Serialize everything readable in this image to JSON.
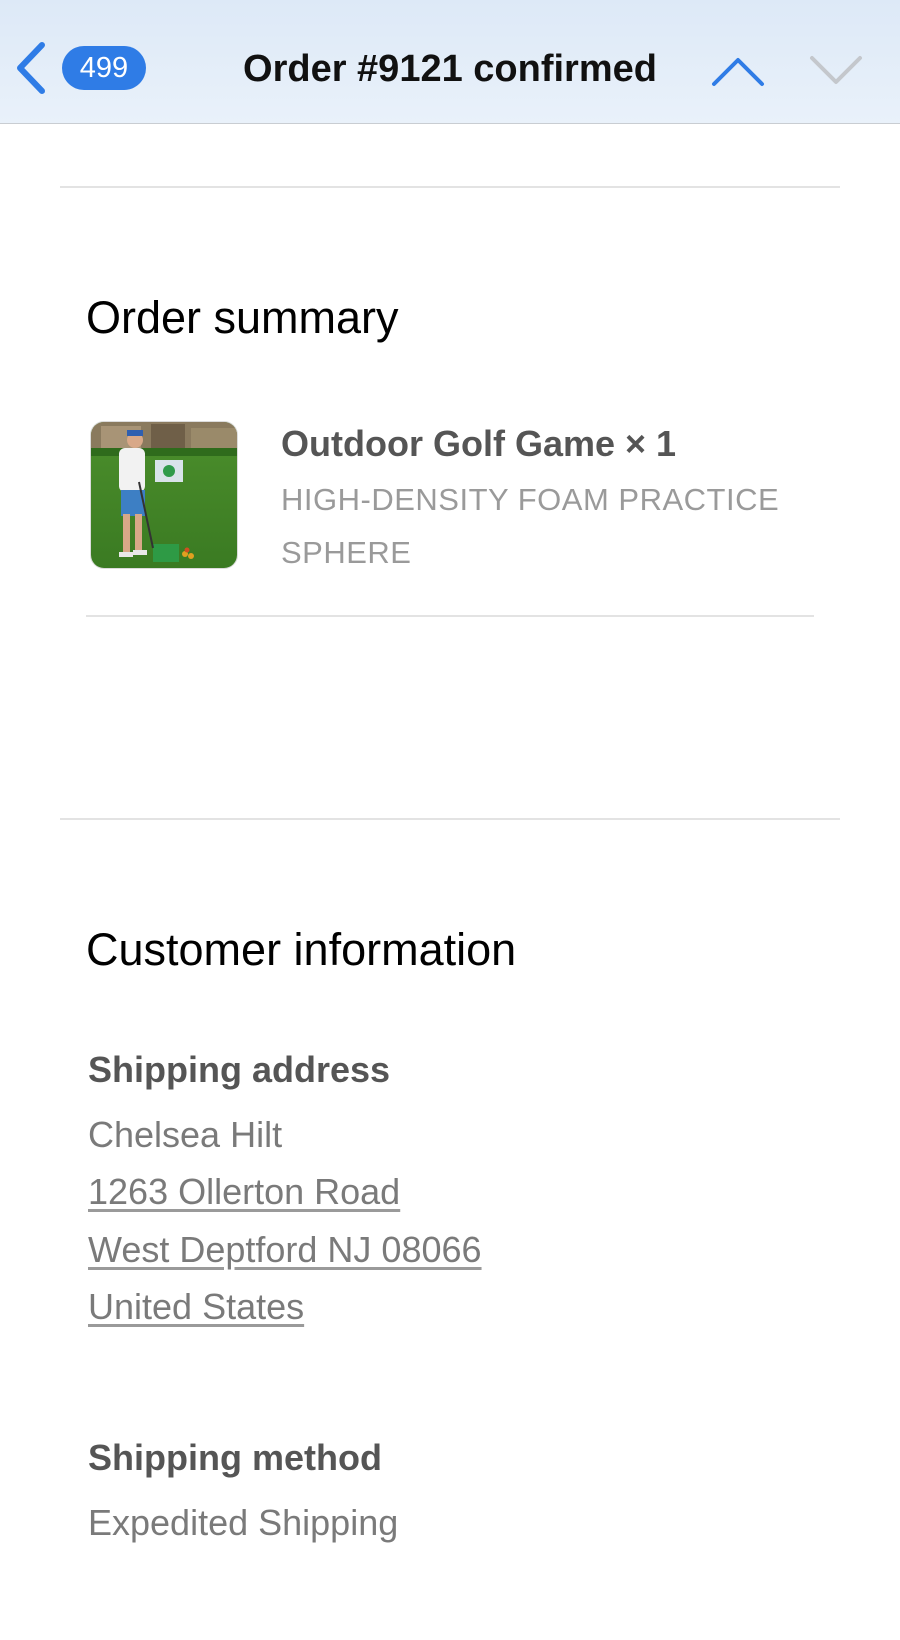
{
  "header": {
    "back_count": "499",
    "title": "Order #9121 confirmed"
  },
  "order_summary": {
    "title": "Order summary",
    "item": {
      "name": "Outdoor Golf Game × 1",
      "variant": "HIGH-DENSITY FOAM PRACTICE SPHERE"
    }
  },
  "customer_info": {
    "title": "Customer information",
    "shipping_address": {
      "label": "Shipping address",
      "name": "Chelsea Hilt",
      "street": "1263 Ollerton Road",
      "city_line": "West Deptford NJ 08066",
      "country": "United States"
    },
    "shipping_method": {
      "label": "Shipping method",
      "value": "Expedited Shipping"
    }
  },
  "colors": {
    "accent": "#2f7ce6",
    "nav_background": "#e4eef9",
    "disabled_arrow": "#c4c7cc"
  },
  "icons": {
    "back": "chevron-left-icon",
    "previous": "chevron-up-icon",
    "next": "chevron-down-icon"
  }
}
